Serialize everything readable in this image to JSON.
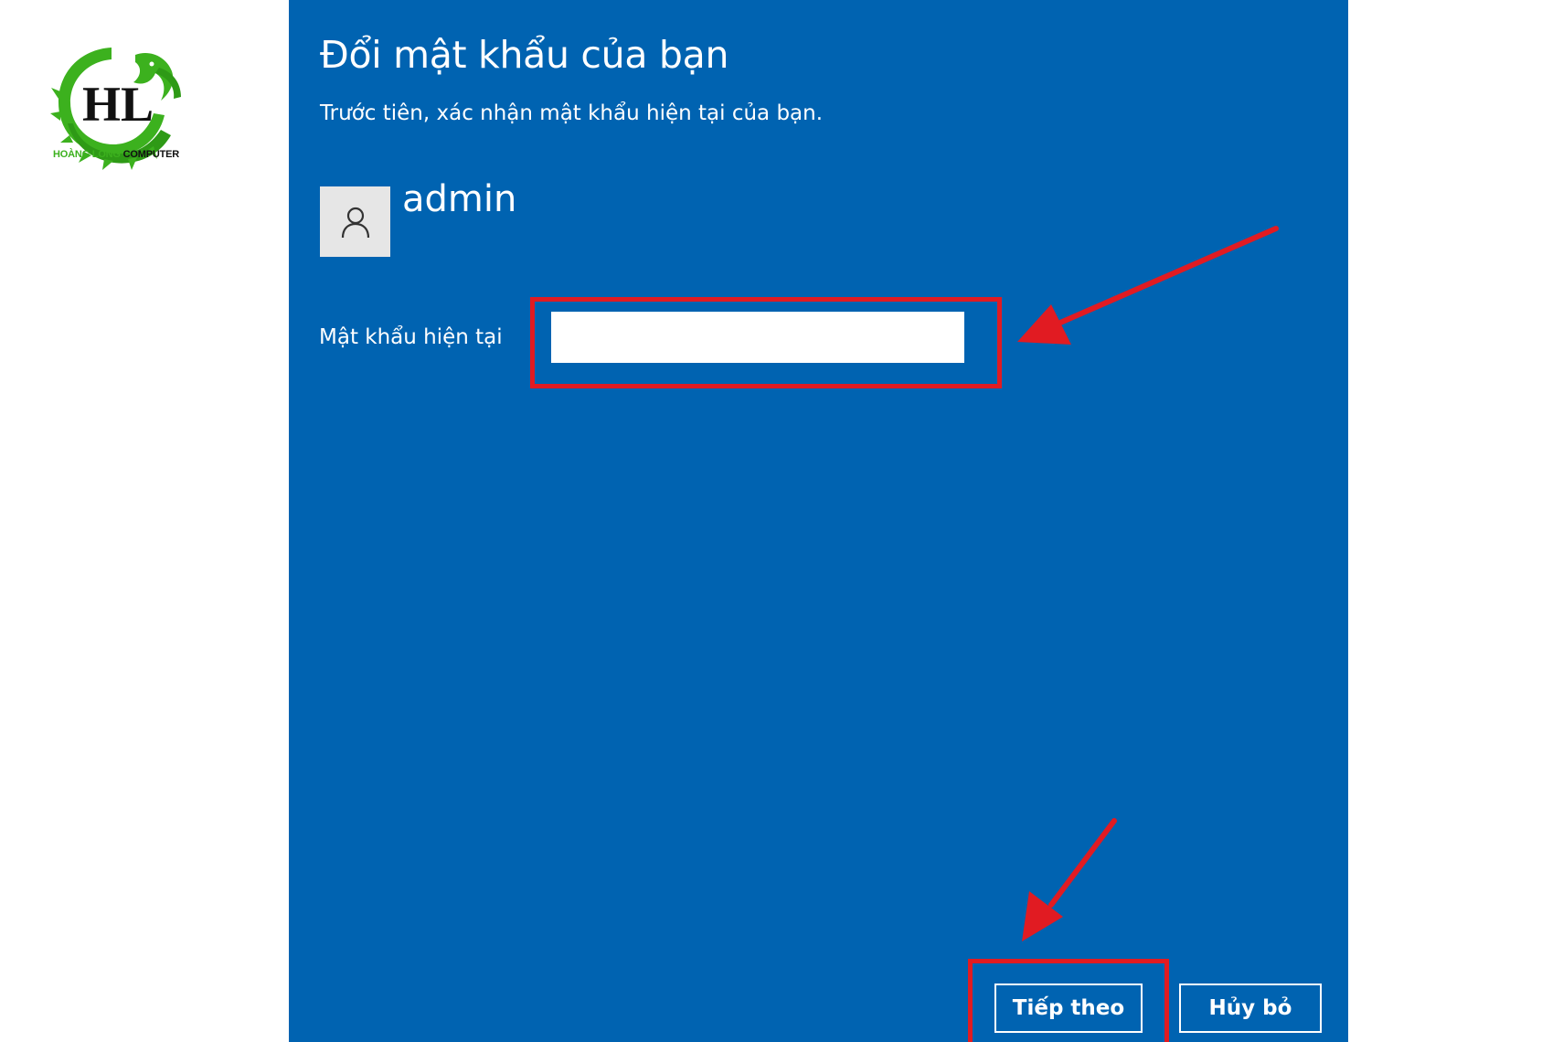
{
  "brand": {
    "logo_name": "HOÀNG LONG",
    "logo_suffix": "COMPUTER",
    "logo_initials": "HL",
    "accent_green": "#3cb11e"
  },
  "dialog": {
    "title": "Đổi mật khẩu của bạn",
    "subtitle": "Trước tiên, xác nhận mật khẩu hiện tại của bạn.",
    "background_color": "#0063b1",
    "account": {
      "avatar_icon": "user-icon",
      "username": "admin"
    },
    "password": {
      "label": "Mật khẩu hiện tại",
      "value": "",
      "placeholder": ""
    },
    "buttons": {
      "next": "Tiếp theo",
      "cancel": "Hủy bỏ"
    }
  },
  "annotations": {
    "highlight_color": "#e11b22",
    "arrow_icon": "red-arrow"
  }
}
